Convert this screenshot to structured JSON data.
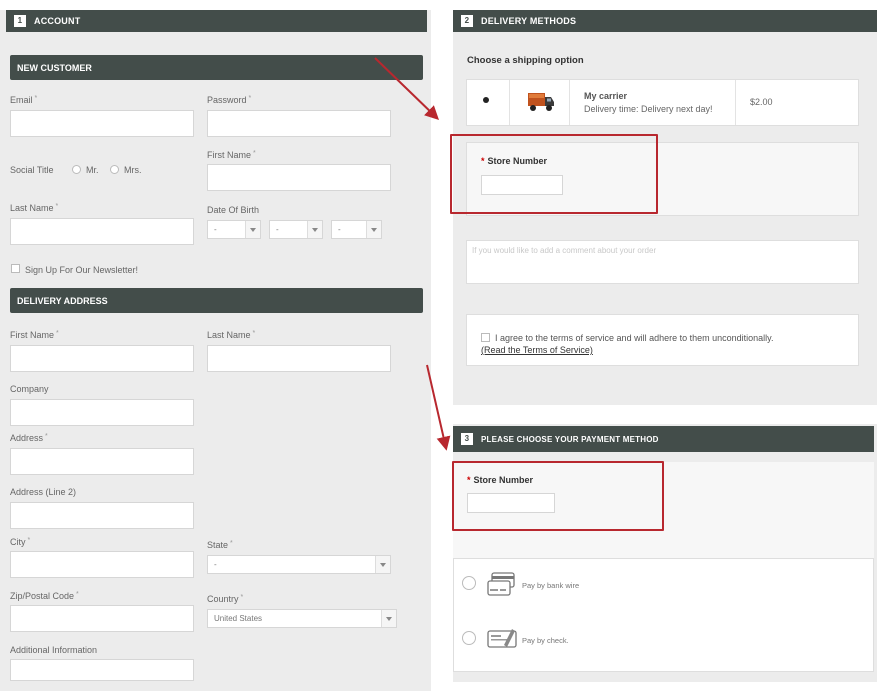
{
  "account": {
    "step": "1",
    "title": "ACCOUNT",
    "new_customer": "NEW CUSTOMER",
    "email_label": "Email",
    "password_label": "Password",
    "social_title_label": "Social Title",
    "mr_label": "Mr.",
    "mrs_label": "Mrs.",
    "first_name_label": "First Name",
    "last_name_label": "Last Name",
    "dob_label": "Date Of Birth",
    "dob_day": "-",
    "dob_month": "-",
    "dob_year": "-",
    "newsletter_label": "Sign Up For Our Newsletter!",
    "required_mark": "*"
  },
  "delivery_address": {
    "title": "DELIVERY ADDRESS",
    "first_name_label": "First Name",
    "last_name_label": "Last Name",
    "company_label": "Company",
    "address_label": "Address",
    "address2_label": "Address (Line 2)",
    "city_label": "City",
    "state_label": "State",
    "state_value": "-",
    "zip_label": "Zip/Postal Code",
    "country_label": "Country",
    "country_value": "United States",
    "additional_label": "Additional Information"
  },
  "delivery": {
    "step": "2",
    "title": "DELIVERY METHODS",
    "choose_label": "Choose a shipping option",
    "carrier_name": "My carrier",
    "carrier_time": "Delivery time: Delivery next day!",
    "carrier_price": "$2.00",
    "store_number_label": "Store Number",
    "comment_placeholder": "If you would like to add a comment about your order",
    "terms_text": "I agree to the terms of service and will adhere to them unconditionally.",
    "terms_link": "(Read the Terms of Service)"
  },
  "payment": {
    "step": "3",
    "title": "PLEASE CHOOSE YOUR PAYMENT METHOD",
    "store_number_label": "Store Number",
    "bankwire_label": "Pay by bank wire",
    "check_label": "Pay by check."
  },
  "colors": {
    "header_bar": "#434d4a",
    "panel_bg": "#ececec",
    "highlight": "#b8282f"
  },
  "icons": [
    "truck-icon",
    "bank-card-icon",
    "check-icon",
    "arrow-annotation"
  ]
}
